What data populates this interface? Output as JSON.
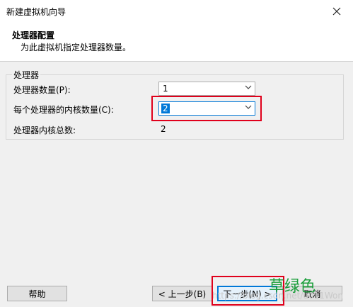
{
  "window": {
    "title": "新建虚拟机向导"
  },
  "header": {
    "title": "处理器配置",
    "description": "为此虚拟机指定处理器数量。"
  },
  "group": {
    "legend": "处理器",
    "processor_count_label": "处理器数量(P):",
    "processor_count_value": "1",
    "cores_per_processor_label": "每个处理器的内核数量(C):",
    "cores_per_processor_value": "2",
    "total_cores_label": "处理器内核总数:",
    "total_cores_value": "2"
  },
  "buttons": {
    "help": "帮助",
    "back": "< 上一步(B)",
    "next": "下一步(N) >",
    "cancel": "取消"
  },
  "annotations": {
    "green_label": "草绿色",
    "watermark": "https://blog.csdn.net/u011Won"
  },
  "colors": {
    "highlight_red": "#e0001b",
    "annotation_green": "#1a9e3a",
    "selection_blue": "#0078d7"
  },
  "icons": {
    "close": "close-icon",
    "dropdown": "chevron-down-icon"
  }
}
